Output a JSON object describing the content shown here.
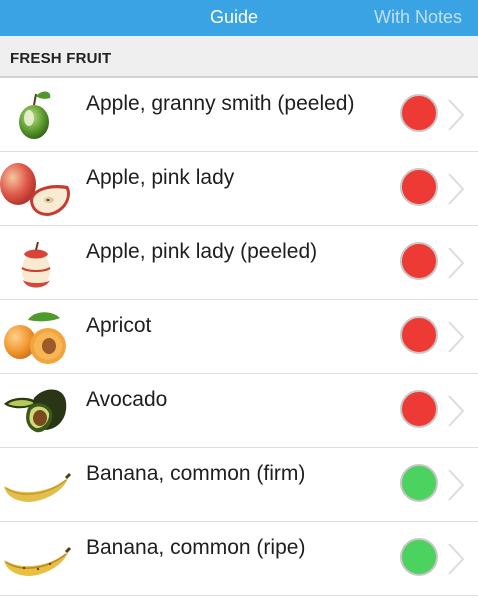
{
  "tabs": {
    "guide": "Guide",
    "with_notes": "With Notes"
  },
  "section": {
    "title": "FRESH FRUIT"
  },
  "colors": {
    "header_bg": "#3aa3e3",
    "status_red": "#ee3a34",
    "status_green": "#4cd25e"
  },
  "items": [
    {
      "name": "Apple, granny smith (peeled)",
      "icon": "granny-smith-apple-icon",
      "status": "red"
    },
    {
      "name": "Apple, pink lady",
      "icon": "pink-lady-apple-icon",
      "status": "red"
    },
    {
      "name": "Apple, pink lady (peeled)",
      "icon": "peeled-apple-icon",
      "status": "red"
    },
    {
      "name": "Apricot",
      "icon": "apricot-icon",
      "status": "red"
    },
    {
      "name": "Avocado",
      "icon": "avocado-icon",
      "status": "red"
    },
    {
      "name": "Banana, common (firm)",
      "icon": "banana-icon",
      "status": "green"
    },
    {
      "name": "Banana, common (ripe)",
      "icon": "banana-icon",
      "status": "green"
    }
  ]
}
